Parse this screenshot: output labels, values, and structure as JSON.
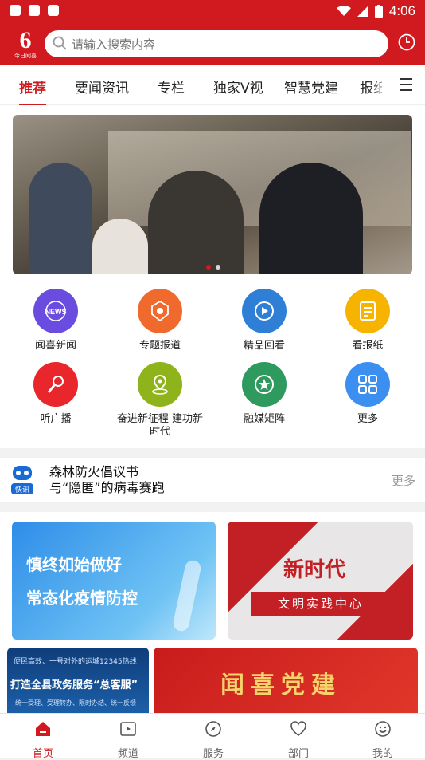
{
  "status_bar": {
    "time": "4:06"
  },
  "app": {
    "logo_number": "6",
    "logo_caption": "今日闻喜",
    "search_placeholder": "请输入搜索内容"
  },
  "tabs": [
    {
      "label": "推荐",
      "active": true
    },
    {
      "label": "要闻资讯",
      "active": false
    },
    {
      "label": "专栏",
      "active": false
    },
    {
      "label": "独家V视",
      "active": false
    },
    {
      "label": "智慧党建",
      "active": false
    },
    {
      "label": "报纸",
      "active": false
    }
  ],
  "banner": {
    "slide_count": 2,
    "active_slide": 1
  },
  "shortcuts": [
    {
      "label": "闻喜新闻",
      "icon": "news-icon",
      "color": "#6a4de0"
    },
    {
      "label": "专题报道",
      "icon": "badge-icon",
      "color": "#f06a2e"
    },
    {
      "label": "精品回看",
      "icon": "replay-icon",
      "color": "#2f7fd6"
    },
    {
      "label": "看报纸",
      "icon": "newspaper-icon",
      "color": "#f6b400"
    },
    {
      "label": "听广播",
      "icon": "microphone-icon",
      "color": "#e8262c"
    },
    {
      "label": "奋进新征程 建功新时代",
      "icon": "location-icon",
      "color": "#8fb31a"
    },
    {
      "label": "融媒矩阵",
      "icon": "star-icon",
      "color": "#2f9a5e"
    },
    {
      "label": "更多",
      "icon": "grid-icon",
      "color": "#3a8ff0"
    }
  ],
  "flash_news": {
    "badge": "快讯",
    "lines": [
      "森林防火倡议书",
      "与“隐匿”的病毒赛跑"
    ],
    "more_label": "更多"
  },
  "cards": {
    "card1": {
      "line1": "慎终如始做好",
      "line2": "常态化疫情防控"
    },
    "card2": {
      "title": "新时代",
      "subtitle": "文明实践中心"
    },
    "card3": {
      "top": "便民高效、一号对外的运城12345热线",
      "title": "打造全县政务服务“总客服”",
      "bottom": "统一受理、受理转办、限时办结、统一反馈"
    },
    "card4": {
      "title": "闻喜党建"
    }
  },
  "bottom_nav": [
    {
      "label": "首页",
      "icon": "home-icon",
      "active": true
    },
    {
      "label": "频道",
      "icon": "play-icon",
      "active": false
    },
    {
      "label": "服务",
      "icon": "compass-icon",
      "active": false
    },
    {
      "label": "部门",
      "icon": "heart-icon",
      "active": false
    },
    {
      "label": "我的",
      "icon": "smile-icon",
      "active": false
    }
  ],
  "colors": {
    "brand": "#d11a1f",
    "text": "#222222",
    "muted": "#999999"
  }
}
